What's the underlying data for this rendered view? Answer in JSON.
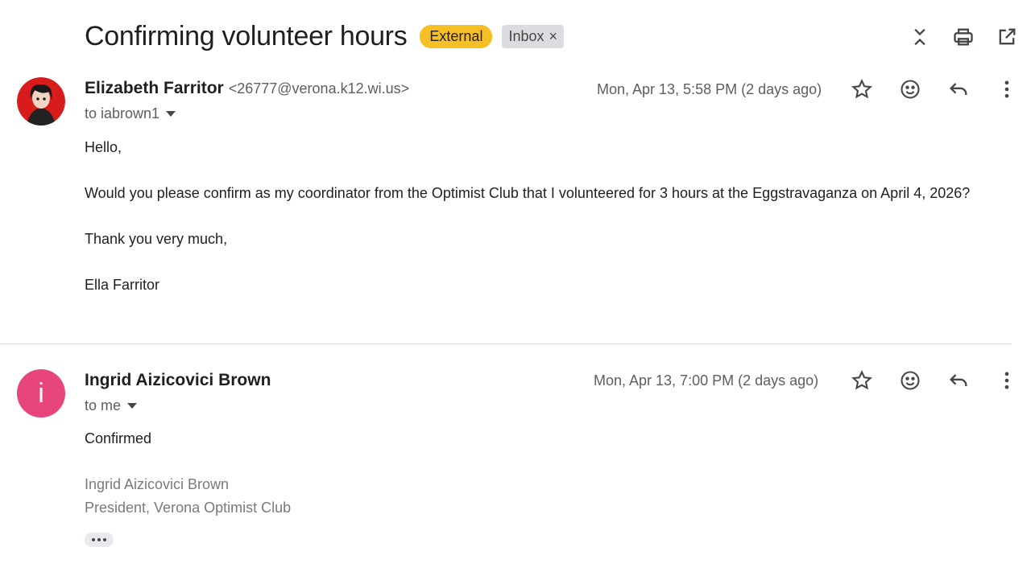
{
  "thread": {
    "subject": "Confirming volunteer hours",
    "badge_external": "External",
    "badge_inbox": "Inbox",
    "badge_inbox_remove": "×"
  },
  "top_actions": [
    "collapse-all-icon",
    "print-icon",
    "open-in-new-window-icon"
  ],
  "messages": [
    {
      "sender_name": "Elizabeth Farritor",
      "sender_email": "<26777@verona.k12.wi.us>",
      "to": "to iabrown1",
      "date": "Mon, Apr 13, 5:58 PM (2 days ago)",
      "avatar": "profile-photo",
      "body": [
        "Hello,",
        "Would you please confirm as my coordinator from the Optimist Club that I volunteered for 3 hours at the Eggstravaganza on April 4, 2026?",
        "Thank you very much,",
        "Ella Farritor"
      ]
    },
    {
      "sender_name": "Ingrid Aizicovici Brown",
      "to": "to me",
      "date": "Mon, Apr 13, 7:00 PM (2 days ago)",
      "avatar_letter": "i",
      "avatar_color": "#e8457c",
      "body": [
        "Confirmed"
      ],
      "signature": [
        "Ingrid Aizicovici Brown",
        "President, Verona Optimist Club"
      ]
    }
  ],
  "message_actions": [
    "star-icon",
    "emoji-reaction-icon",
    "reply-icon",
    "more-options-icon"
  ],
  "colors": {
    "external_badge": "#f6bf26",
    "inbox_badge": "#dadce0"
  }
}
